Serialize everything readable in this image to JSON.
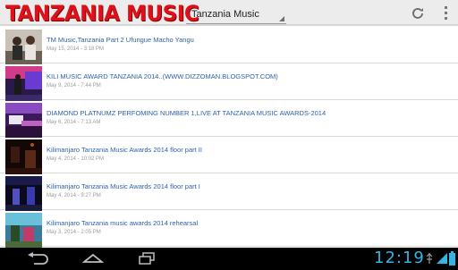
{
  "header": {
    "logo_text": "TANZANIA MUSIC",
    "spinner_value": "Tanzania Music",
    "accent_color": "#e0101a"
  },
  "videos": [
    {
      "title": "TM Music,Tanzania Part 2 Ufungue Macho Yangu",
      "date": "May 15, 2014 - 3:18 PM"
    },
    {
      "title": "KILI MUSIC AWARD TANZANIA 2014..(WWW.DIZZOMAN.BLOGSPOT.COM)",
      "date": "May 9, 2014 - 7:44 PM"
    },
    {
      "title": "DIAMOND PLATNUMZ PERFOMING NUMBER 1,LIVE AT TANZANIA MUSIC AWARDS-2014",
      "date": "May 6, 2014 - 7:13 AM"
    },
    {
      "title": "Kilimanjaro Tanzania Music Awards 2014 floor part II",
      "date": "May 4, 2014 - 10:02 PM"
    },
    {
      "title": "Kilimanjaro Tanzania Music Awards 2014 floor part I",
      "date": "May 4, 2014 - 9:27 PM"
    },
    {
      "title": "Kilimanjaro Tanzania music awards 2014 rehearsal",
      "date": "May 3, 2014 - 2:05 PM"
    }
  ],
  "system_bar": {
    "clock": "12:19",
    "clock_color": "#33b5e5",
    "icons": [
      "back-icon",
      "home-icon",
      "recent-apps-icon",
      "usb-icon",
      "wifi-icon",
      "battery-icon"
    ]
  }
}
